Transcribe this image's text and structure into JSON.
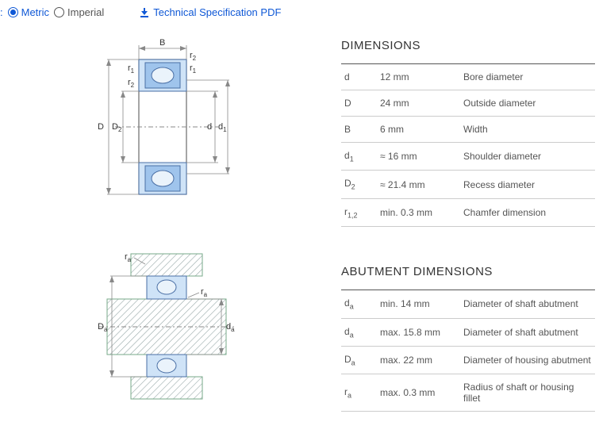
{
  "topbar": {
    "metric": "Metric",
    "imperial": "Imperial",
    "pdf": "Technical Specification PDF"
  },
  "dimensions": {
    "title": "DIMENSIONS",
    "rows": [
      {
        "sym": "d",
        "sub": "",
        "val": "12 mm",
        "desc": "Bore diameter"
      },
      {
        "sym": "D",
        "sub": "",
        "val": "24 mm",
        "desc": "Outside diameter"
      },
      {
        "sym": "B",
        "sub": "",
        "val": "6 mm",
        "desc": "Width"
      },
      {
        "sym": "d",
        "sub": "1",
        "val": "≈ 16 mm",
        "desc": "Shoulder diameter"
      },
      {
        "sym": "D",
        "sub": "2",
        "val": "≈ 21.4 mm",
        "desc": "Recess diameter"
      },
      {
        "sym": "r",
        "sub": "1,2",
        "val": "min. 0.3 mm",
        "desc": "Chamfer dimension"
      }
    ]
  },
  "abutment": {
    "title": "ABUTMENT DIMENSIONS",
    "rows": [
      {
        "sym": "d",
        "sub": "a",
        "val": "min. 14 mm",
        "desc": "Diameter of shaft abutment"
      },
      {
        "sym": "d",
        "sub": "a",
        "val": "max. 15.8 mm",
        "desc": "Diameter of shaft abutment"
      },
      {
        "sym": "D",
        "sub": "a",
        "val": "max. 22 mm",
        "desc": "Diameter of housing abutment"
      },
      {
        "sym": "r",
        "sub": "a",
        "val": "max. 0.3 mm",
        "desc": "Radius of shaft or housing fillet"
      }
    ]
  },
  "diagram1_labels": {
    "B": "B",
    "r2": "r",
    "r2s": "2",
    "r1": "r",
    "r1s": "1",
    "r1b": "r",
    "r1bs": "1",
    "r2b": "r",
    "r2bs": "2",
    "D": "D",
    "D2": "D",
    "D2s": "2",
    "d": "d",
    "d1": "d",
    "d1s": "1"
  },
  "diagram2_labels": {
    "ra": "r",
    "ras": "a",
    "ra2": "r",
    "ra2s": "a",
    "Da": "D",
    "Das": "a",
    "da": "d",
    "das": "a"
  }
}
